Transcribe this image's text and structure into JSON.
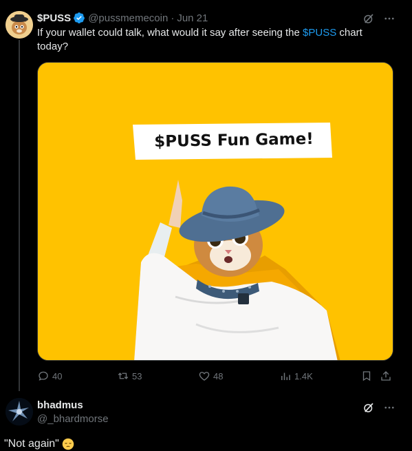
{
  "tweet": {
    "author_name": "$PUSS",
    "author_handle": "@pussmemecoin",
    "separator": "·",
    "date": "Jun 21",
    "text_before": "If your wallet could talk, what would it say after seeing the ",
    "cashtag": "$PUSS",
    "text_after": " chart today?",
    "media": {
      "banner_text": "$PUSS Fun Game!",
      "background_color": "#ffc200"
    },
    "actions": {
      "replies": "40",
      "retweets": "53",
      "likes": "48",
      "views": "1.4K"
    }
  },
  "reply": {
    "author_name": "bhadmus",
    "author_handle": "@_bhardmorse",
    "text": "\"Not again\""
  },
  "colors": {
    "accent": "#1d9bf0",
    "secondary_text": "#71767b",
    "background": "#000000"
  },
  "icons": [
    "verified-badge-icon",
    "grok-icon",
    "more-icon",
    "reply-icon",
    "retweet-icon",
    "like-icon",
    "views-icon",
    "bookmark-icon",
    "share-icon",
    "pensive-emoji-icon"
  ]
}
